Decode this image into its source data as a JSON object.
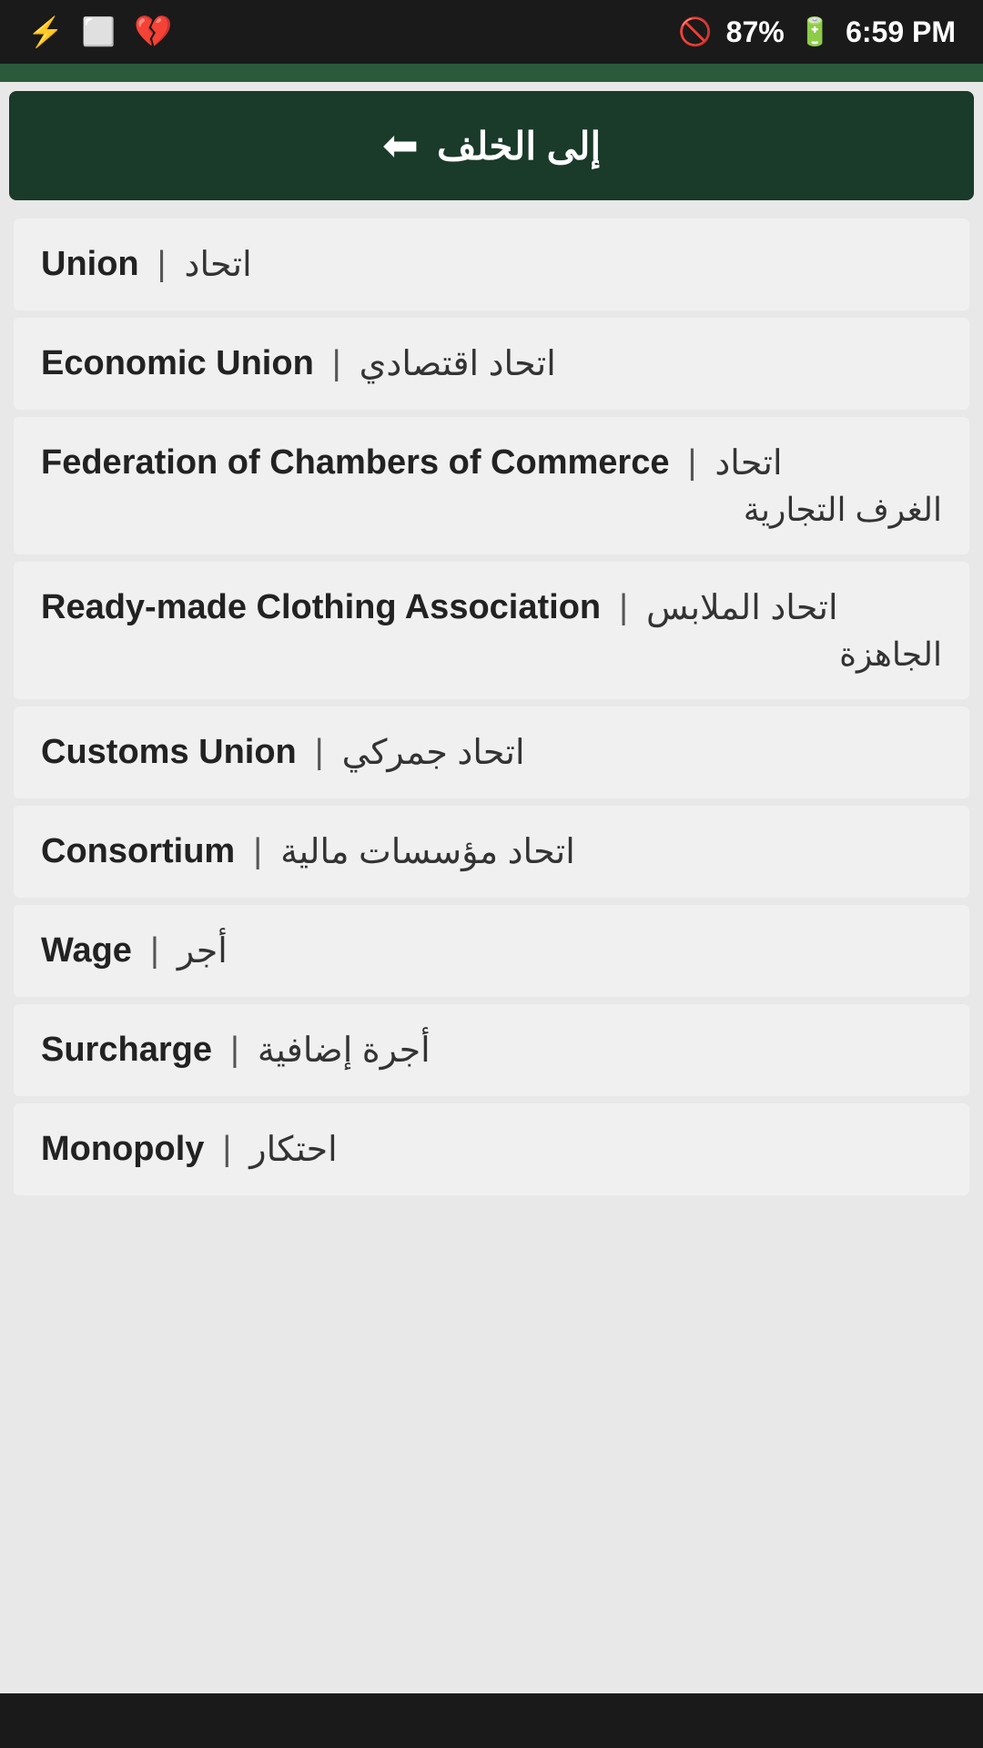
{
  "statusBar": {
    "battery": "87%",
    "time": "6:59 PM",
    "icons": {
      "usb": "⚡",
      "image": "🖼",
      "app": "💔"
    }
  },
  "backButton": {
    "label": "إلى الخلف",
    "icon": "⬅"
  },
  "words": [
    {
      "english": "Union",
      "separator": "|",
      "arabic": "اتحاد",
      "multiline": false
    },
    {
      "english": "Economic Union",
      "separator": "|",
      "arabic": "اتحاد اقتصادي",
      "multiline": false
    },
    {
      "english": "Federation of Chambers of Commerce",
      "separator": "|",
      "arabic": "اتحاد",
      "arabic2": "الغرف التجارية",
      "multiline": true
    },
    {
      "english": "Ready-made Clothing Association",
      "separator": "|",
      "arabic": "اتحاد الملابس",
      "arabic2": "الجاهزة",
      "multiline": true
    },
    {
      "english": "Customs Union",
      "separator": "|",
      "arabic": "اتحاد جمركي",
      "multiline": false
    },
    {
      "english": "Consortium",
      "separator": "|",
      "arabic": "اتحاد مؤسسات مالية",
      "multiline": false
    },
    {
      "english": "Wage",
      "separator": "|",
      "arabic": "أجر",
      "multiline": false
    },
    {
      "english": "Surcharge",
      "separator": "|",
      "arabic": "أجرة إضافية",
      "multiline": false
    },
    {
      "english": "Monopoly",
      "separator": "|",
      "arabic": "احتكار",
      "multiline": false
    }
  ]
}
